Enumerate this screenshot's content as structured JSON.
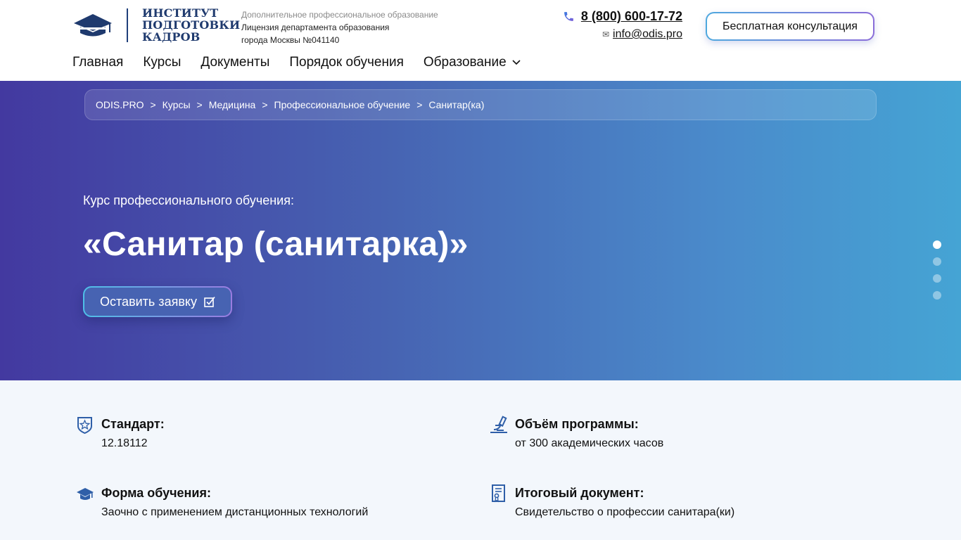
{
  "header": {
    "logo_lines": [
      "ИНСТИТУТ",
      "ПОДГОТОВКИ",
      "КАДРОВ"
    ],
    "license_line1": "Дополнительное профессиональное образование",
    "license_line2": "Лицензия департамента образования",
    "license_line3": "города Москвы №041140",
    "phone": "8 (800) 600-17-72",
    "email": "info@odis.pro",
    "consult_label": "Бесплатная консультация"
  },
  "nav": {
    "items": [
      "Главная",
      "Курсы",
      "Документы",
      "Порядок обучения",
      "Образование"
    ]
  },
  "breadcrumb": {
    "items": [
      "ODIS.PRO",
      "Курсы",
      "Медицина",
      "Профессиональное обучение",
      "Санитар(ка)"
    ],
    "separator": ">"
  },
  "hero": {
    "subtitle": "Курс профессионального обучения:",
    "title": "«Санитар (санитарка)»",
    "apply_label": "Оставить заявку",
    "slides_count": 4,
    "active_slide": 1
  },
  "features": [
    {
      "label": "Стандарт:",
      "value": "12.18112",
      "icon": "shield-star-icon"
    },
    {
      "label": "Объём программы:",
      "value": "от 300 академических часов",
      "icon": "microscope-icon"
    },
    {
      "label": "Форма обучения:",
      "value": "Заочно с применением дистанционных технологий",
      "icon": "graduation-cap-icon"
    },
    {
      "label": "Итоговый документ:",
      "value": "Свидетельство о профессии санитара(ки)",
      "icon": "certificate-icon"
    }
  ],
  "colors": {
    "brand_dark": "#1f3a6e",
    "hero_start": "#4339a0",
    "hero_end": "#45a4d4",
    "icon_blue": "#2f5fa8"
  }
}
